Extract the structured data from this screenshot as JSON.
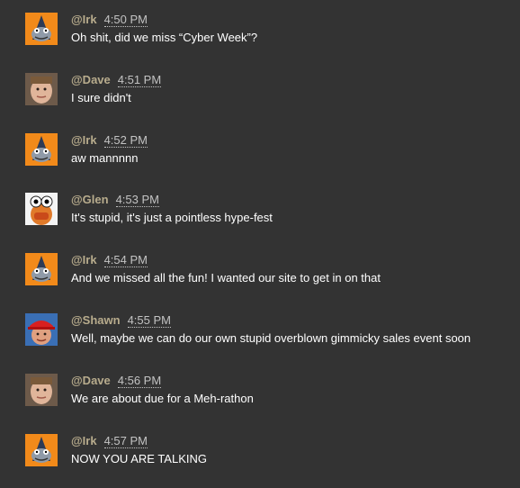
{
  "messages": [
    {
      "user": "@Irk",
      "time": "4:50 PM",
      "text": "Oh shit, did we miss “Cyber Week”?",
      "avatar": "irk-avatar"
    },
    {
      "user": "@Dave",
      "time": "4:51 PM",
      "text": "I sure didn't",
      "avatar": "dave-avatar"
    },
    {
      "user": "@Irk",
      "time": "4:52 PM",
      "text": "aw mannnnn",
      "avatar": "irk-avatar"
    },
    {
      "user": "@Glen",
      "time": "4:53 PM",
      "text": "It's stupid, it's just a pointless hype-fest",
      "avatar": "glen-avatar"
    },
    {
      "user": "@Irk",
      "time": "4:54 PM",
      "text": "And we missed all the fun! I wanted our site to get in on that",
      "avatar": "irk-avatar"
    },
    {
      "user": "@Shawn",
      "time": "4:55 PM",
      "text": "Well, maybe we can do our own stupid overblown gimmicky sales event soon",
      "avatar": "shawn-avatar"
    },
    {
      "user": "@Dave",
      "time": "4:56 PM",
      "text": "We are about due for a Meh-rathon",
      "avatar": "dave-avatar"
    },
    {
      "user": "@Irk",
      "time": "4:57 PM",
      "text": "NOW YOU ARE TALKING",
      "avatar": "irk-avatar"
    }
  ],
  "colors": {
    "background": "#333333",
    "username": "#b8ac8d",
    "timestamp": "#c3c3c3",
    "message": "#ffffff"
  }
}
